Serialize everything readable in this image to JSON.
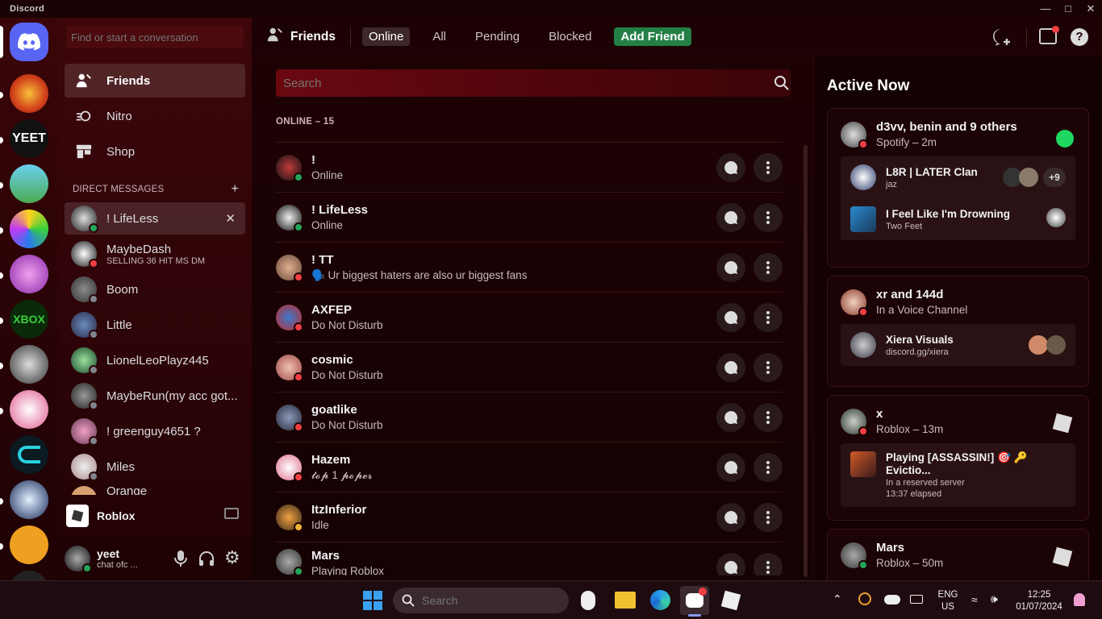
{
  "window": {
    "app_title": "Discord"
  },
  "sidebar": {
    "search_placeholder": "Find or start a conversation",
    "nav": [
      {
        "label": "Friends"
      },
      {
        "label": "Nitro"
      },
      {
        "label": "Shop"
      }
    ],
    "dm_header": "DIRECT MESSAGES",
    "dms": [
      {
        "name": "! LifeLess",
        "status": "on",
        "sub": ""
      },
      {
        "name": "MaybeDash",
        "status": "dnd",
        "sub": "SELLING 36 HIT MS DM"
      },
      {
        "name": "Boom",
        "status": "off",
        "sub": ""
      },
      {
        "name": "Little",
        "status": "off",
        "sub": ""
      },
      {
        "name": "LionelLeoPlayz445",
        "status": "off",
        "sub": ""
      },
      {
        "name": "MaybeRun(my acc got...",
        "status": "off",
        "sub": ""
      },
      {
        "name": "! greenguy4651 ?",
        "status": "off",
        "sub": ""
      },
      {
        "name": "Miles",
        "status": "off",
        "sub": ""
      },
      {
        "name": "Orange",
        "status": "off",
        "sub": ""
      }
    ],
    "activity": "Roblox",
    "user": {
      "name": "yeet",
      "status": "chat ofc ..."
    }
  },
  "topbar": {
    "title": "Friends",
    "tabs": [
      "Online",
      "All",
      "Pending",
      "Blocked"
    ],
    "add_friend": "Add Friend"
  },
  "friends": {
    "search_placeholder": "Search",
    "header": "ONLINE – 15",
    "list": [
      {
        "name": "!",
        "sub": "Online",
        "status": "on"
      },
      {
        "name": "! LifeLess",
        "sub": "Online",
        "status": "on"
      },
      {
        "name": "! TT",
        "sub": "🗣️ Ur biggest haters are also ur biggest fans",
        "status": "dnd"
      },
      {
        "name": "AXFEP",
        "sub": "Do Not Disturb",
        "status": "dnd"
      },
      {
        "name": "cosmic",
        "sub": "Do Not Disturb",
        "status": "dnd"
      },
      {
        "name": "goatlike",
        "sub": "Do Not Disturb",
        "status": "dnd"
      },
      {
        "name": "Hazem",
        "sub": "𝓽𝓸𝓹 1 𝓹𝓸𝓹𝓮𝓻",
        "status": "dnd"
      },
      {
        "name": "ItzInferior",
        "sub": "Idle",
        "status": "idle"
      },
      {
        "name": "Mars",
        "sub": "Playing Roblox",
        "status": "on"
      }
    ]
  },
  "active_now": {
    "title": "Active Now",
    "cards": [
      {
        "name": "d3vv, benin and 9 others",
        "sub": "Spotify – 2m",
        "rows": [
          {
            "t1": "L8R | LATER Clan",
            "t2": "jaz",
            "extra": "+9"
          },
          {
            "t1": "I Feel Like I'm Drowning",
            "t2": "Two Feet",
            "extra": ""
          }
        ]
      },
      {
        "name": "xr and 144d",
        "sub": "In a Voice Channel",
        "rows": [
          {
            "t1": "Xiera Visuals",
            "t2": "discord.gg/xiera",
            "extra": ""
          }
        ]
      },
      {
        "name": "x",
        "sub": "Roblox – 13m",
        "rows": [
          {
            "t1": "Playing [ASSASSIN!] 🎯 🔑 Evictio...",
            "t2": "In a reserved server",
            "t3": "13:37 elapsed",
            "extra": ""
          }
        ]
      },
      {
        "name": "Mars",
        "sub": "Roblox – 50m",
        "rows": []
      }
    ]
  },
  "taskbar": {
    "search_placeholder": "Search",
    "lang1": "ENG",
    "lang2": "US",
    "time": "12:25",
    "date": "01/07/2024"
  },
  "colors": {
    "accent": "#5865f2",
    "add_friend": "#248046",
    "online": "#23a55a",
    "dnd": "#f23f43",
    "idle": "#f0b232",
    "offline": "#80848e"
  }
}
